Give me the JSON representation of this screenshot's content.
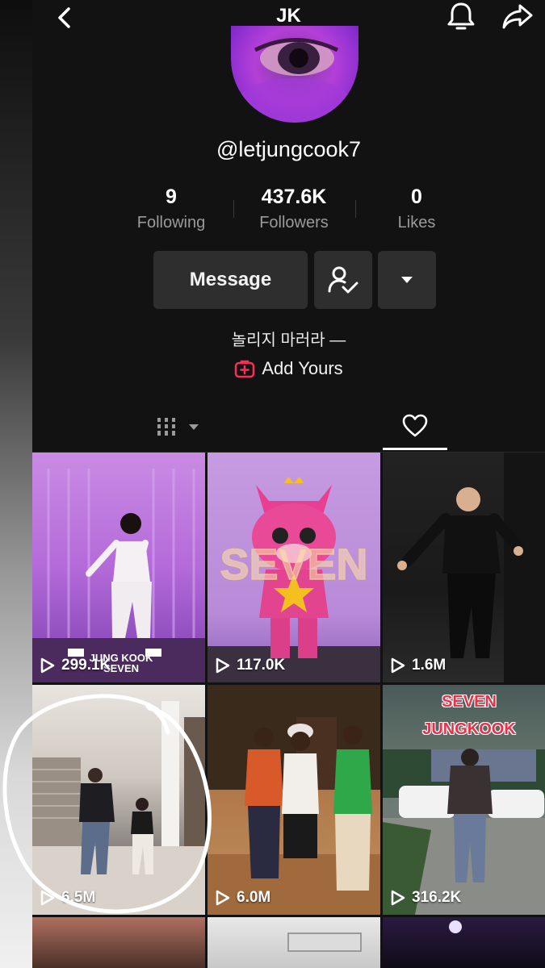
{
  "header": {
    "title": "JK"
  },
  "profile": {
    "username": "@letjungcook7",
    "bio": "놀리지 마러라 —",
    "add_yours_label": "Add Yours"
  },
  "stats": [
    {
      "value": "9",
      "label": "Following"
    },
    {
      "value": "437.6K",
      "label": "Followers"
    },
    {
      "value": "0",
      "label": "Likes"
    }
  ],
  "actions": {
    "message_label": "Message"
  },
  "tabs": {
    "active": "liked"
  },
  "videos": [
    {
      "views": "299.1K",
      "caption": "JUNG KOOK\nSEVEN"
    },
    {
      "views": "117.0K",
      "caption": "SEVEN"
    },
    {
      "views": "1.6M"
    },
    {
      "views": "6.5M",
      "circled": true
    },
    {
      "views": "6.0M"
    },
    {
      "views": "316.2K",
      "caption_line1": "SEVEN",
      "caption_line2": "JUNGKOOK"
    }
  ],
  "colors": {
    "background": "#121212",
    "button": "#2e2e2e",
    "muted_text": "#9a9a9a",
    "add_yours_icon": "#fe2c55"
  },
  "icons": [
    "back-chevron-icon",
    "bell-icon",
    "share-icon",
    "follow-check-icon",
    "caret-down-icon",
    "grid-icon",
    "heart-icon",
    "play-icon",
    "add-yours-icon"
  ]
}
